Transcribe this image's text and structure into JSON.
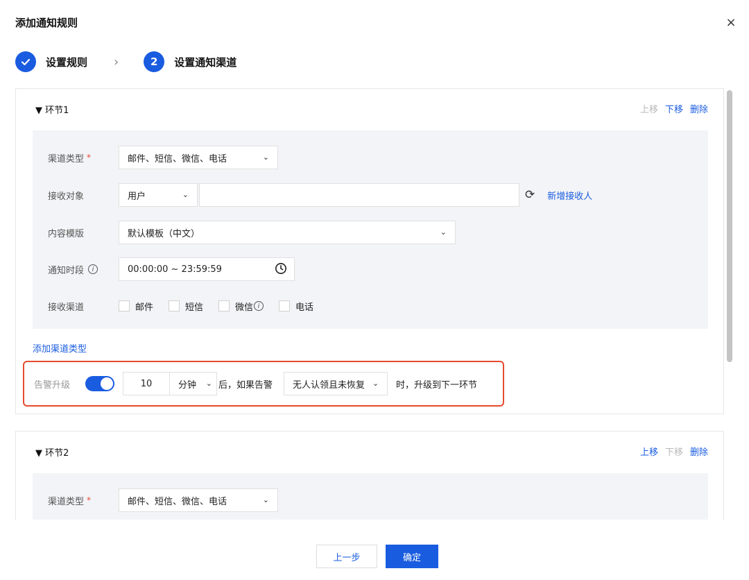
{
  "dialog": {
    "title": "添加通知规则",
    "close": "×"
  },
  "steps": [
    {
      "label": "设置规则"
    },
    {
      "number": "2",
      "label": "设置通知渠道"
    }
  ],
  "stages": [
    {
      "title": "▼ 环节1",
      "actions": {
        "up": "上移",
        "down": "下移",
        "delete": "删除"
      },
      "channel_type": {
        "label": "渠道类型",
        "value": "邮件、短信、微信、电话"
      },
      "receiver": {
        "label": "接收对象",
        "type": "用户",
        "value": "",
        "add": "新增接收人"
      },
      "template": {
        "label": "内容模版",
        "value": "默认模板（中文）"
      },
      "period": {
        "label": "通知时段",
        "value": "00:00:00 ~ 23:59:59"
      },
      "channels": {
        "label": "接收渠道",
        "options": [
          "邮件",
          "短信",
          "微信",
          "电话"
        ]
      },
      "add_channel_type": "添加渠道类型",
      "escalation": {
        "label": "告警升级",
        "enabled": true,
        "minutes": "10",
        "unit": "分钟",
        "text1": "后，如果告警",
        "condition": "无人认领且未恢复",
        "text2": "时，升级到下一环节"
      }
    },
    {
      "title": "▼ 环节2",
      "actions": {
        "up": "上移",
        "down": "下移",
        "delete": "删除"
      },
      "channel_type": {
        "label": "渠道类型",
        "value": "邮件、短信、微信、电话"
      }
    }
  ],
  "footer": {
    "prev": "上一步",
    "ok": "确定"
  },
  "colors": {
    "accent": "#1a5ce0",
    "highlight": "#e64a2e",
    "disabled": "#b8b8b8"
  }
}
